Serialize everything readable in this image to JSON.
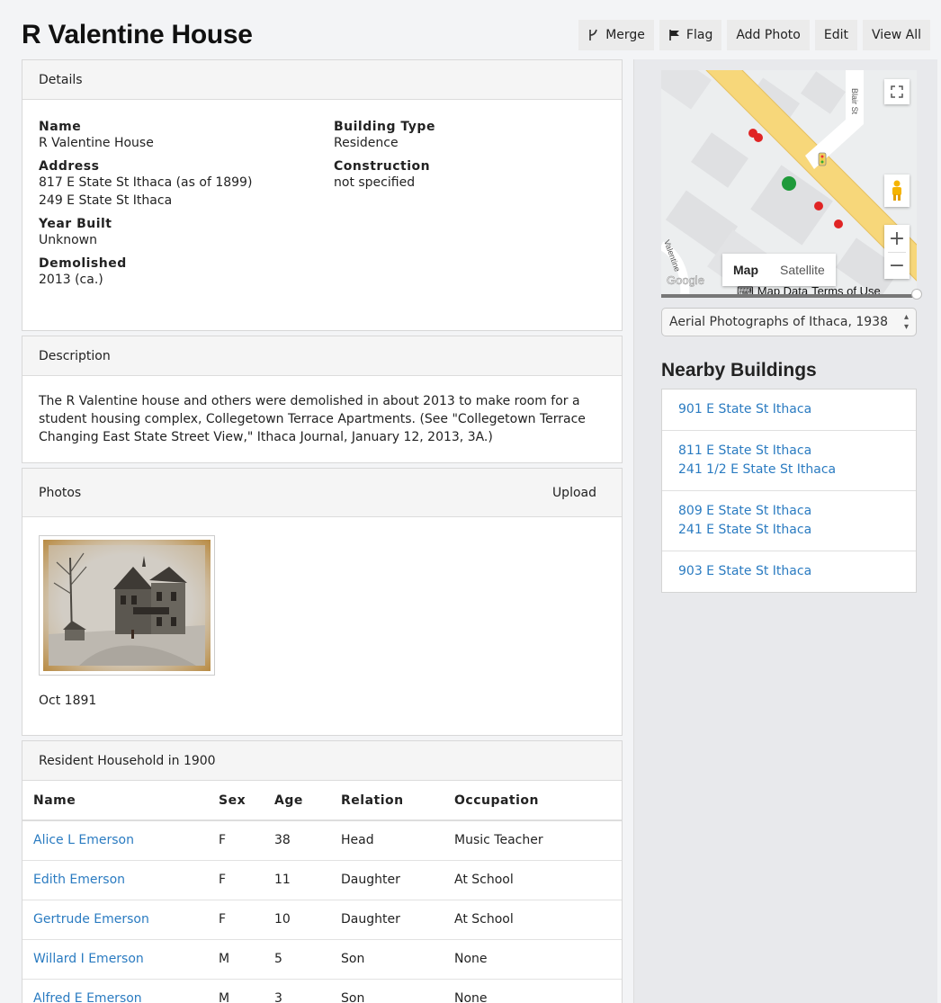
{
  "page": {
    "title": "R Valentine House"
  },
  "toolbar": {
    "merge_label": "Merge",
    "flag_label": "Flag",
    "add_photo_label": "Add Photo",
    "edit_label": "Edit",
    "view_all_label": "View All"
  },
  "details": {
    "heading": "Details",
    "name_label": "Name",
    "name_value": "R Valentine House",
    "address_label": "Address",
    "address_line1": "817 E State St Ithaca (as of 1899)",
    "address_line2": "249 E State St Ithaca",
    "year_built_label": "Year Built",
    "year_built_value": "Unknown",
    "demolished_label": "Demolished",
    "demolished_value": "2013 (ca.)",
    "building_type_label": "Building Type",
    "building_type_value": "Residence",
    "construction_label": "Construction",
    "construction_value": "not specified"
  },
  "description": {
    "heading": "Description",
    "text": "The R Valentine house and others were demolished in about 2013 to make room for a student housing complex, Collegetown Terrace Apartments. (See \"Collegetown Terrace Changing East State Street View,\" Ithaca Journal, January 12, 2013, 3A.)"
  },
  "photos": {
    "heading": "Photos",
    "upload_label": "Upload",
    "items": [
      {
        "caption": "Oct 1891"
      }
    ]
  },
  "residents": {
    "heading": "Resident Household in 1900",
    "columns": [
      "Name",
      "Sex",
      "Age",
      "Relation",
      "Occupation"
    ],
    "rows": [
      {
        "name": "Alice L Emerson",
        "sex": "F",
        "age": "38",
        "relation": "Head",
        "occupation": "Music Teacher"
      },
      {
        "name": "Edith Emerson",
        "sex": "F",
        "age": "11",
        "relation": "Daughter",
        "occupation": "At School"
      },
      {
        "name": "Gertrude Emerson",
        "sex": "F",
        "age": "10",
        "relation": "Daughter",
        "occupation": "At School"
      },
      {
        "name": "Willard I Emerson",
        "sex": "M",
        "age": "5",
        "relation": "Son",
        "occupation": "None"
      },
      {
        "name": "Alfred E Emerson",
        "sex": "M",
        "age": "3",
        "relation": "Son",
        "occupation": "None"
      }
    ]
  },
  "map": {
    "street_label": "Blair St",
    "street_label_2": "Valentine",
    "google_logo": "Google",
    "type_map": "Map",
    "type_satellite": "Satellite",
    "map_data": "Map Data",
    "terms": "Terms of Use",
    "zoom_in": "+",
    "zoom_out": "−",
    "layer_select": "Aerial Photographs of Ithaca, 1938",
    "colors": {
      "road": "#f7d77a",
      "marker_red": "#e02424",
      "marker_green": "#1f9a3a"
    }
  },
  "nearby": {
    "heading": "Nearby Buildings",
    "items": [
      {
        "line1": "901 E State St Ithaca",
        "line2": ""
      },
      {
        "line1": "811 E State St Ithaca",
        "line2": "241 1/2 E State St Ithaca"
      },
      {
        "line1": "809 E State St Ithaca",
        "line2": "241 E State St Ithaca"
      },
      {
        "line1": "903 E State St Ithaca",
        "line2": ""
      }
    ]
  }
}
